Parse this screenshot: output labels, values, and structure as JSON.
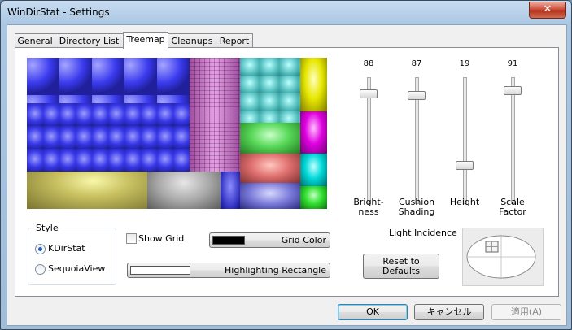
{
  "window": {
    "title": "WinDirStat - Settings",
    "close_glyph": "✕"
  },
  "tabs": [
    {
      "label": "General"
    },
    {
      "label": "Directory List"
    },
    {
      "label": "Treemap",
      "active": true
    },
    {
      "label": "Cleanups"
    },
    {
      "label": "Report"
    }
  ],
  "sliders": [
    {
      "value": "88",
      "label_line1": "Bright-",
      "label_line2": "ness"
    },
    {
      "value": "87",
      "label_line1": "Cushion",
      "label_line2": "Shading"
    },
    {
      "value": "19",
      "label_line1": "Height",
      "label_line2": ""
    },
    {
      "value": "91",
      "label_line1": "Scale",
      "label_line2": "Factor"
    }
  ],
  "style_group": {
    "legend": "Style",
    "options": [
      {
        "label": "KDirStat",
        "selected": true
      },
      {
        "label": "SequoiaView",
        "selected": false
      }
    ]
  },
  "show_grid": {
    "label": "Show Grid",
    "checked": false
  },
  "grid_color": {
    "label": "Grid Color",
    "swatch": "#000000"
  },
  "highlight_rect": {
    "label": "Highlighting Rectangle",
    "swatch": "#ffffff"
  },
  "light_incidence": {
    "label": "Light Incidence"
  },
  "reset_button": {
    "line1": "Reset to",
    "line2": "Defaults"
  },
  "footer": {
    "ok": "OK",
    "cancel": "キャンセル",
    "apply": "適用(A)"
  },
  "colors": {
    "blue": "#4040ff",
    "pink": "#c060c0",
    "cyan": "#40c0c0",
    "yellow": "#ffff30",
    "magenta": "#ff20ff",
    "green": "#40ff40",
    "red": "#ff6060"
  }
}
